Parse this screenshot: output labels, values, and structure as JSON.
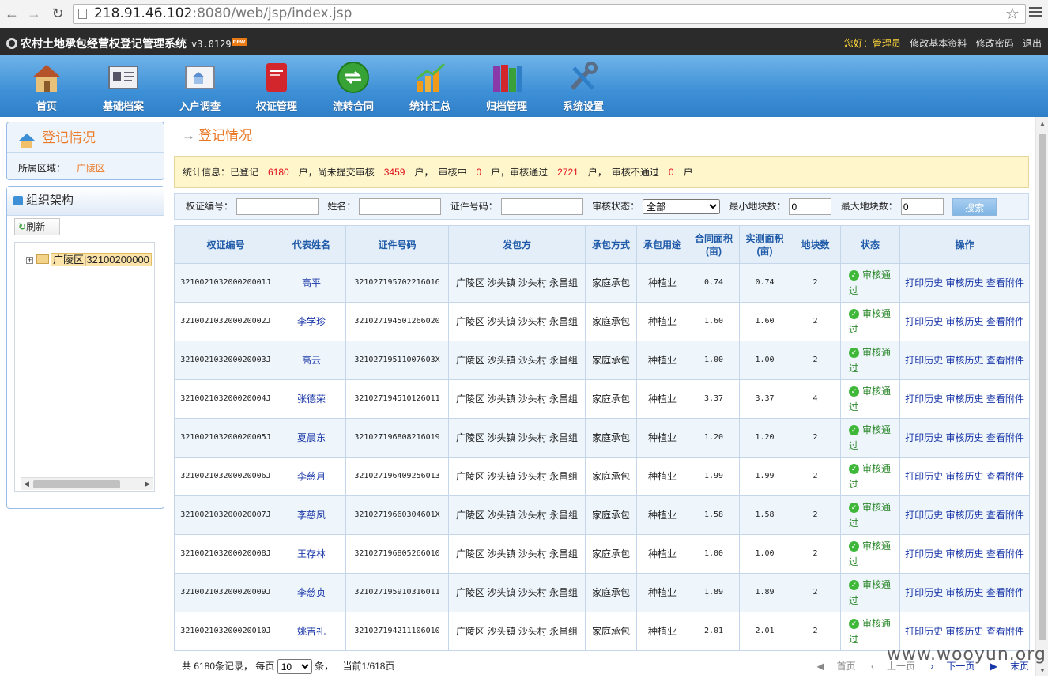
{
  "browser": {
    "url_host": "218.91.46.102",
    "url_path": ":8080/web/jsp/index.jsp"
  },
  "header": {
    "title": "农村土地承包经营权登记管理系统",
    "version": "v3.0129",
    "badge": "new",
    "greeting_label": "您好：",
    "user": "管理员",
    "links": [
      "修改基本资料",
      "修改密码",
      "退出"
    ]
  },
  "toolbar": [
    {
      "label": "首页",
      "icon": "house-icon",
      "color": "#c8823c"
    },
    {
      "label": "基础档案",
      "icon": "id-card-icon",
      "color": "#8a8f99"
    },
    {
      "label": "入户调查",
      "icon": "survey-icon",
      "color": "#9aa3b0"
    },
    {
      "label": "权证管理",
      "icon": "certificate-book-icon",
      "color": "#d3262c"
    },
    {
      "label": "流转合同",
      "icon": "transfer-arrows-icon",
      "color": "#3aa13a"
    },
    {
      "label": "统计汇总",
      "icon": "chart-icon",
      "color": "#f09a1a"
    },
    {
      "label": "归档管理",
      "icon": "archive-binders-icon",
      "color": "#8a3aa8"
    },
    {
      "label": "系统设置",
      "icon": "tools-icon",
      "color": "#5a6d86"
    }
  ],
  "left": {
    "reg_title": "登记情况",
    "region_label": "所属区域：",
    "region_value": "广陵区",
    "org_title": "组织架构",
    "refresh_label": "刷新",
    "tree_node": "广陵区|32100200000"
  },
  "main": {
    "title": "登记情况"
  },
  "stats": {
    "prefix": "统计信息：已登记",
    "registered": "6180",
    "t1": "户，尚未提交审核",
    "not_submitted": "3459",
    "t2": "户，　审核中",
    "reviewing": "0",
    "t3": "户，审核通过",
    "passed": "2721",
    "t4": "户，　审核不通过",
    "failed": "0",
    "t5": "户"
  },
  "search": {
    "cert_label": "权证编号：",
    "name_label": "姓名：",
    "id_label": "证件号码：",
    "status_label": "审核状态：",
    "status_value": "全部",
    "min_label": "最小地块数：",
    "min_value": "0",
    "max_label": "最大地块数：",
    "max_value": "0",
    "button": "搜索"
  },
  "table": {
    "headers": [
      "权证编号",
      "代表姓名",
      "证件号码",
      "发包方",
      "承包方式",
      "承包用途",
      "合同面积(亩)",
      "实测面积(亩)",
      "地块数",
      "状态",
      "操作"
    ],
    "status_text": "审核通过",
    "ops": [
      "打印历史",
      "审核历史",
      "查看附件"
    ],
    "rows": [
      [
        "321002103200020001J",
        "高平",
        "321027195702216016",
        "广陵区 沙头镇 沙头村 永昌组",
        "家庭承包",
        "种植业",
        "0.74",
        "0.74",
        "2"
      ],
      [
        "321002103200020002J",
        "李学珍",
        "321027194501266020",
        "广陵区 沙头镇 沙头村 永昌组",
        "家庭承包",
        "种植业",
        "1.60",
        "1.60",
        "2"
      ],
      [
        "321002103200020003J",
        "高云",
        "32102719511007603X",
        "广陵区 沙头镇 沙头村 永昌组",
        "家庭承包",
        "种植业",
        "1.00",
        "1.00",
        "2"
      ],
      [
        "321002103200020004J",
        "张德荣",
        "321027194510126011",
        "广陵区 沙头镇 沙头村 永昌组",
        "家庭承包",
        "种植业",
        "3.37",
        "3.37",
        "4"
      ],
      [
        "321002103200020005J",
        "夏晨东",
        "321027196808216019",
        "广陵区 沙头镇 沙头村 永昌组",
        "家庭承包",
        "种植业",
        "1.20",
        "1.20",
        "2"
      ],
      [
        "321002103200020006J",
        "李慈月",
        "321027196409256013",
        "广陵区 沙头镇 沙头村 永昌组",
        "家庭承包",
        "种植业",
        "1.99",
        "1.99",
        "2"
      ],
      [
        "321002103200020007J",
        "李慈凤",
        "32102719660304601X",
        "广陵区 沙头镇 沙头村 永昌组",
        "家庭承包",
        "种植业",
        "1.58",
        "1.58",
        "2"
      ],
      [
        "321002103200020008J",
        "王存林",
        "321027196805266010",
        "广陵区 沙头镇 沙头村 永昌组",
        "家庭承包",
        "种植业",
        "1.00",
        "1.00",
        "2"
      ],
      [
        "321002103200020009J",
        "李慈贞",
        "321027195910316011",
        "广陵区 沙头镇 沙头村 永昌组",
        "家庭承包",
        "种植业",
        "1.89",
        "1.89",
        "2"
      ],
      [
        "321002103200020010J",
        "姚吉礼",
        "321027194211106010",
        "广陵区 沙头镇 沙头村 永昌组",
        "家庭承包",
        "种植业",
        "2.01",
        "2.01",
        "2"
      ]
    ]
  },
  "pager": {
    "total": "共 6180条记录，",
    "per_label": "每页",
    "per_value": "10",
    "unit": "条，",
    "current": "当前1/618页",
    "first": "首页",
    "prev": "上一页",
    "next": "下一页",
    "last": "末页"
  },
  "watermark": "www.wooyun.org"
}
